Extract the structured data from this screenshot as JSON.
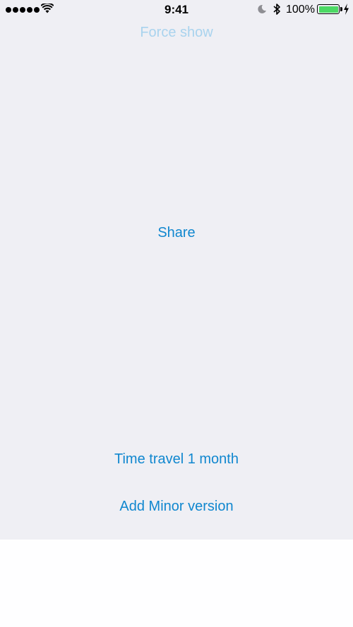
{
  "status_bar": {
    "time": "9:41",
    "battery_percent": "100%",
    "signal_icon": "signal-dots-icon",
    "wifi_icon": "wifi-icon",
    "moon_icon": "do-not-disturb-icon",
    "bluetooth_icon": "bluetooth-icon",
    "battery_icon": "battery-icon",
    "charging_icon": "charging-bolt-icon",
    "battery_color": "#4cd964"
  },
  "buttons": {
    "force_show": "Force show",
    "share": "Share",
    "time_travel": "Time travel 1 month",
    "add_minor": "Add Minor version"
  },
  "colors": {
    "accent": "#1087cf",
    "accent_faded": "#a9d3ee",
    "background": "#efeff4"
  }
}
